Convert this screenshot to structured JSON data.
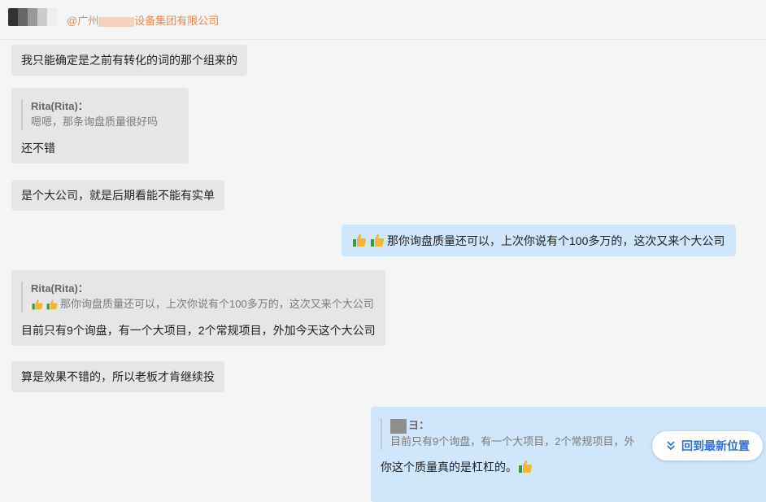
{
  "header": {
    "mention_prefix": "@广州",
    "mention_suffix": "设备集团有限公司"
  },
  "messages": {
    "m1": "我只能确定是之前有转化的词的那个组来的",
    "m2_quote_name": "Rita(Rita)：",
    "m2_quote_text": "嗯嗯，那条询盘质量很好吗",
    "m2_text": "还不错",
    "m3": "是个大公司，就是后期看能不能有实单",
    "m4": "那你询盘质量还可以，上次你说有个100多万的，这次又来个大公司",
    "m5_quote_name": "Rita(Rita)：",
    "m5_quote_text": "那你询盘质量还可以，上次你说有个100多万的，这次又来个大公司",
    "m5_text": "目前只有9个询盘，有一个大项目，2个常规项目，外加今天这个大公司",
    "m6": "算是效果不错的，所以老板才肯继续投",
    "m7_quote_name": "ヨ：",
    "m7_quote_text": "目前只有9个询盘，有一个大项目，2个常规项目，外",
    "m7_text": "你这个质量真的是杠杠的。"
  },
  "scroll_button": {
    "label": "回到最新位置",
    "icon": "double-chevron-down-icon"
  },
  "colors": {
    "incoming_bubble": "#e6e6e6",
    "outgoing_bubble": "#cfe6fb",
    "mention": "#e8884a",
    "link": "#2f6fd6",
    "thumb": "#f2b632"
  }
}
